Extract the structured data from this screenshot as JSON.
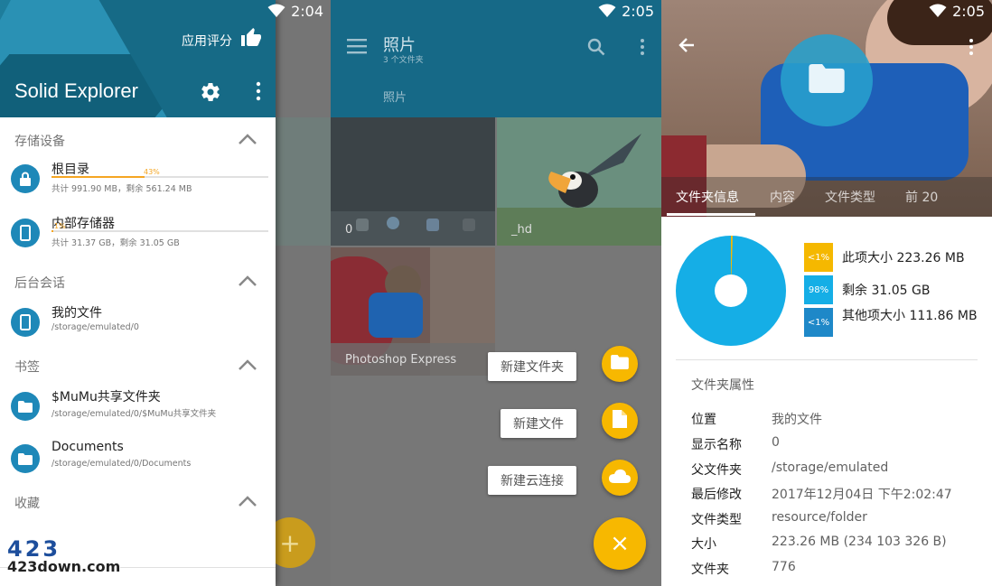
{
  "panel1": {
    "time": "2:04",
    "app_title": "Solid Explorer",
    "rate_label": "应用评分",
    "sections": {
      "storage": "存储设备",
      "sessions": "后台会话",
      "bookmarks": "书签",
      "favorites": "收藏"
    },
    "items": {
      "root": {
        "title": "根目录",
        "percent": "43%",
        "percent_value": 0.43,
        "sub": "共计 991.90 MB，剩余 561.24 MB"
      },
      "internal": {
        "title": "内部存储器",
        "percent": "1%",
        "percent_value": 0.01,
        "sub": "共计 31.37 GB，剩余 31.05 GB"
      },
      "myfiles": {
        "title": "我的文件",
        "sub": "/storage/emulated/0"
      },
      "mumu": {
        "title": "$MuMu共享文件夹",
        "sub": "/storage/emulated/0/$MuMu共享文件夹"
      },
      "documents": {
        "title": "Documents",
        "sub": "/storage/emulated/0/Documents"
      }
    },
    "fab_icon": "+",
    "watermark_logo": "423",
    "watermark_text": "423down.com"
  },
  "panel2": {
    "time": "2:05",
    "title": "照片",
    "subtitle": "3 个文件夹",
    "breadcrumb": "照片",
    "tiles": {
      "t1": "0",
      "t2": "_hd",
      "t3": "Photoshop Express"
    },
    "menu": {
      "new_folder": "新建文件夹",
      "new_file": "新建文件",
      "new_cloud": "新建云连接"
    },
    "fab_icon": "×"
  },
  "panel3": {
    "time": "2:05",
    "tabs": [
      "文件夹信息",
      "内容",
      "文件类型",
      "前 20"
    ],
    "legend": [
      {
        "badge": "<1%",
        "text": "此项大小 223.26 MB",
        "color": "#f5b800"
      },
      {
        "badge": "98%",
        "text": "剩余 31.05 GB",
        "color": "#15aee6"
      },
      {
        "badge": "<1%",
        "text": "其他项大小 111.86 MB",
        "color": "#1e88c8"
      }
    ],
    "props_title": "文件夹属性",
    "props": [
      {
        "k": "位置",
        "v": "我的文件"
      },
      {
        "k": "显示名称",
        "v": "0"
      },
      {
        "k": "父文件夹",
        "v": "/storage/emulated"
      },
      {
        "k": "最后修改",
        "v": "2017年12月04日 下午2:02:47"
      },
      {
        "k": "文件类型",
        "v": "resource/folder"
      },
      {
        "k": "大小",
        "v": "223.26 MB (234 103 326 B)"
      },
      {
        "k": "文件夹",
        "v": "776"
      }
    ]
  },
  "colors": {
    "accent": "#f7b800",
    "primary": "#1e88b8",
    "pie_free": "#15aee6",
    "pie_item": "#f5b800"
  }
}
